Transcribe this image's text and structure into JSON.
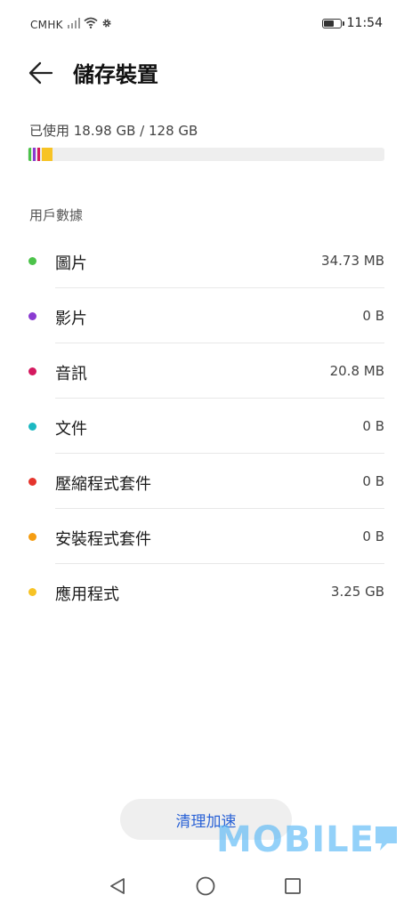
{
  "status_bar": {
    "carrier": "CMHK",
    "time": "11:54",
    "icons": [
      "signal-icon",
      "wifi-icon",
      "settings-gear-icon",
      "battery-icon"
    ]
  },
  "header": {
    "title": "儲存裝置",
    "back_icon": "arrow-left-icon"
  },
  "usage": {
    "text": "已使用 18.98 GB / 128 GB",
    "segments": [
      {
        "name": "圖片",
        "color": "#4cc34a"
      },
      {
        "name": "影片",
        "color": "#8a3bd1"
      },
      {
        "name": "音訊",
        "color": "#d4195f"
      },
      {
        "name": "應用程式",
        "color": "#f7c325"
      }
    ]
  },
  "section_label": "用戶數據",
  "items": [
    {
      "label": "圖片",
      "value": "34.73 MB",
      "color": "#4cc34a"
    },
    {
      "label": "影片",
      "value": "0 B",
      "color": "#8a3bd1"
    },
    {
      "label": "音訊",
      "value": "20.8 MB",
      "color": "#d4195f"
    },
    {
      "label": "文件",
      "value": "0 B",
      "color": "#1cb8c2"
    },
    {
      "label": "壓縮程式套件",
      "value": "0 B",
      "color": "#e5352d"
    },
    {
      "label": "安裝程式套件",
      "value": "0 B",
      "color": "#f59d12"
    },
    {
      "label": "應用程式",
      "value": "3.25 GB",
      "color": "#f7c325"
    }
  ],
  "clean_button": "清理加速",
  "watermark": "MOBILE",
  "navbar": {
    "icons": [
      "back-triangle-icon",
      "home-circle-icon",
      "recents-square-icon"
    ]
  }
}
